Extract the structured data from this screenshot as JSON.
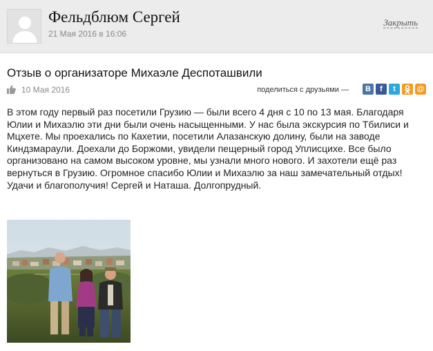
{
  "author": {
    "name": "Фельдблюм Сергей",
    "date": "21 Мая 2016 в 16:06"
  },
  "header": {
    "close_label": "Закрыть"
  },
  "review": {
    "title": "Отзыв о организаторе Михаэле Деспоташвили",
    "date": "10 Мая 2016",
    "share_label": "поделиться с друзьями —",
    "share_icons": [
      {
        "name": "vkontakte-icon",
        "glyph": "B",
        "color": "#4c75a3"
      },
      {
        "name": "facebook-icon",
        "glyph": "f",
        "color": "#3b5998"
      },
      {
        "name": "twitter-icon",
        "glyph": "t",
        "color": "#2aa9e0"
      },
      {
        "name": "odnoklassniki-icon",
        "glyph": "ok",
        "color": "#f59a20"
      },
      {
        "name": "mail-icon",
        "glyph": "@",
        "color": "#f59a20"
      }
    ],
    "text": "В этом году первый раз посетили Грузию — были всего 4 дня с 10 по 13 мая. Благодаря Юлии и Михаэлю эти дни были очень насыщенными. У нас была экскурсия по Тбилиси и Мцхете. Мы проехались по Кахетии, посетили Алазанскую долину, были на заводе Киндзмараули. Доехали до Боржоми, увидели пещерный город Уплисцихе. Все было организовано на самом высоком уровне, мы узнали много нового. И захотели ещё раз вернуться в Грузию. Огромное спасибо Юлии и Михаэлю за наш замечательный отдых! Удачи и благополучия! Сергей и Наташа. Долгопрудный."
  },
  "colors": {
    "header_bg": "#ececec",
    "meta_gray": "#888888"
  }
}
